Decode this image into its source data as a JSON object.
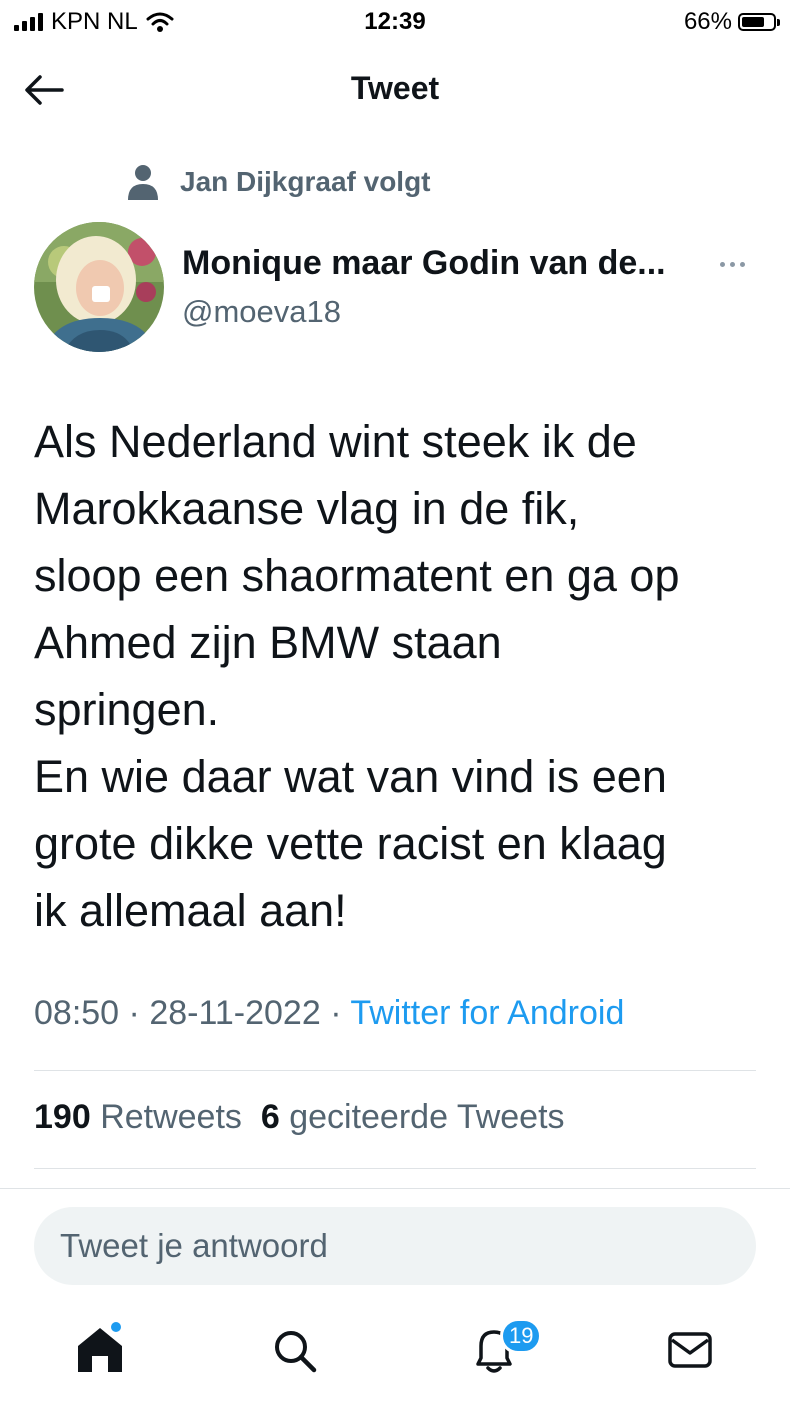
{
  "status_bar": {
    "carrier": "KPN NL",
    "time": "12:39",
    "battery": "66%",
    "battery_level": 0.66
  },
  "header": {
    "title": "Tweet",
    "back_icon": "arrow-left-icon"
  },
  "context": {
    "text": "Jan Dijkgraaf volgt",
    "icon": "person-icon"
  },
  "author": {
    "name": "Monique maar Godin van de...",
    "handle": "@moeva18"
  },
  "tweet": {
    "lines": [
      "Als Nederland wint steek ik de",
      "Marokkaanse vlag in de fik,",
      "sloop een shaormatent en ga op",
      "Ahmed zijn BMW staan",
      "springen.",
      "En wie daar wat van vind is een",
      "grote dikke vette racist en klaag",
      "ik allemaal aan!"
    ],
    "time": "08:50",
    "date": "28-11-2022",
    "source": "Twitter for Android",
    "separator": "·"
  },
  "stats": {
    "retweets_count": "190",
    "retweets_label": "Retweets",
    "quotes_count": "6",
    "quotes_label": "geciteerde Tweets"
  },
  "reply": {
    "placeholder": "Tweet je antwoord"
  },
  "bottom_nav": {
    "items": [
      "home-icon",
      "search-icon",
      "notifications-icon",
      "messages-icon"
    ],
    "notifications_badge": "19"
  },
  "colors": {
    "accent": "#1d9bf0",
    "secondary_text": "#536471",
    "primary_text": "#0f1419"
  }
}
